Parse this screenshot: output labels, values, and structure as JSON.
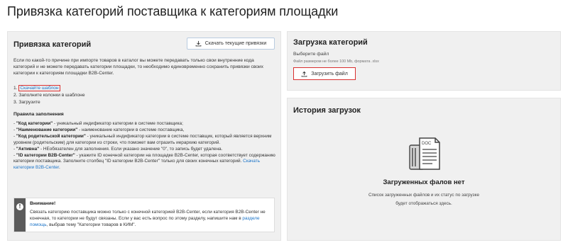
{
  "page": {
    "title": "Привязка категорий поставщика к категориям площадки"
  },
  "binding_panel": {
    "heading": "Привязка категорий",
    "download_button": {
      "label": "Скачать текущие привязки",
      "icon": "download-icon"
    },
    "intro": "Если по какой-то причине при импорте товаров в каталог вы можете передавать только свои внутренние кода категорий и не можете передавать категории площадки, то необходимо единовременно сохранить привязки своих категории к категориям площадки B2B-Center.",
    "steps": [
      {
        "num": "1.",
        "link": "Скачайте шаблон"
      },
      {
        "num": "2.",
        "text": "Заполните колонки в шаблоне"
      },
      {
        "num": "3.",
        "text": "Загрузите"
      }
    ],
    "rules_title": "Правила заполнения",
    "rules": [
      {
        "prefix": "- ",
        "bold": "\"Код категории\"",
        "text": " - уникальный индификатор категории в системе поставщика;"
      },
      {
        "prefix": "- ",
        "bold": "\"Наименование категории\"",
        "text": " - наименование категории в системе поставщика,"
      },
      {
        "prefix": "- ",
        "bold": "\"Код родительской категории\"",
        "text": " - уникальный индификатор категории в системе поставщик, который является верхним уровнем (родительским) для категории из строки, что поможет вам отразить иерархию категорий."
      },
      {
        "prefix": "- ",
        "bold": "\"Активна\"",
        "text": " - НЕобязателен для заполнения. Если указано значение \"0\", то запись будет удалена."
      },
      {
        "prefix": "- ",
        "bold": "\"ID категории B2B-Center\"",
        "text": " - укажите ID конечной категории на площадке B2B-Center, которая соответствует содержанию категории поставщика. Заполните столбец \"ID категории B2B-Center\" только для своих конечных категорий.",
        "link": "Скачать категории B2B-Center",
        "after": "."
      }
    ],
    "notice": {
      "icon": "info-icon",
      "icon_glyph": "!",
      "title": "Внимание!",
      "text_before": "Связать категорию поставщика можно только с конечной категорией B2B-Center, если категория B2B-Center не конечная, то категории не будут связаны. Если у вас есть вопрос по этому разделу, напишите нам в ",
      "link": "разделе помощь",
      "text_after": ", выбрав тему \"Категории товаров в КИМ\"."
    }
  },
  "upload_panel": {
    "heading": "Загрузка категорий",
    "label": "Выберите файл",
    "hint": "Файл размером не более 100 Mb, формата .xlsx",
    "button": {
      "label": "Загрузить файл",
      "icon": "upload-icon"
    }
  },
  "history_panel": {
    "heading": "История загрузок",
    "illustration": {
      "icon": "documents-icon",
      "doc_label": "DOC"
    },
    "empty_title": "Загруженных фалов нет",
    "empty_text_line1": "Список загруженных файлов и их статус по загрузке",
    "empty_text_line2": "будет отображаться здесь."
  },
  "colors": {
    "panel_bg": "#f0f0f0",
    "link": "#1a73c7",
    "highlight": "#d93030",
    "notice_bar": "#5b5b5b"
  }
}
